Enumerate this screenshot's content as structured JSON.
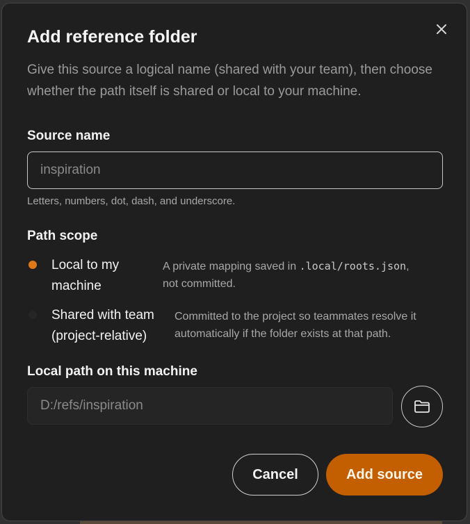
{
  "dialog": {
    "title": "Add reference folder",
    "subtitle": "Give this source a logical name (shared with your team), then choose whether the path itself is shared or local to your machine.",
    "close_icon": "close-icon"
  },
  "source_name": {
    "label": "Source name",
    "placeholder": "inspiration",
    "hint": "Letters, numbers, dot, dash, and underscore."
  },
  "path_scope": {
    "label": "Path scope",
    "options": [
      {
        "label_line1": "Local to my",
        "label_line2": "machine",
        "desc_before": "A private mapping saved in ",
        "desc_code": ".local/roots.json",
        "desc_after": ",",
        "desc_line2": "not committed.",
        "selected": true
      },
      {
        "label_line1": "Shared with team",
        "label_line2": "(project-relative)",
        "desc_line1": "Committed to the project so teammates resolve it",
        "desc_line2": "automatically if the folder exists at that path.",
        "selected": false
      }
    ]
  },
  "local_path": {
    "label": "Local path on this machine",
    "placeholder": "D:/refs/inspiration",
    "browse_icon": "folder-icon"
  },
  "actions": {
    "cancel_label": "Cancel",
    "add_label": "Add source"
  },
  "colors": {
    "accent": "#c35f00",
    "radio_selected": "#e07818",
    "dialog_bg": "#1f1f1f"
  }
}
